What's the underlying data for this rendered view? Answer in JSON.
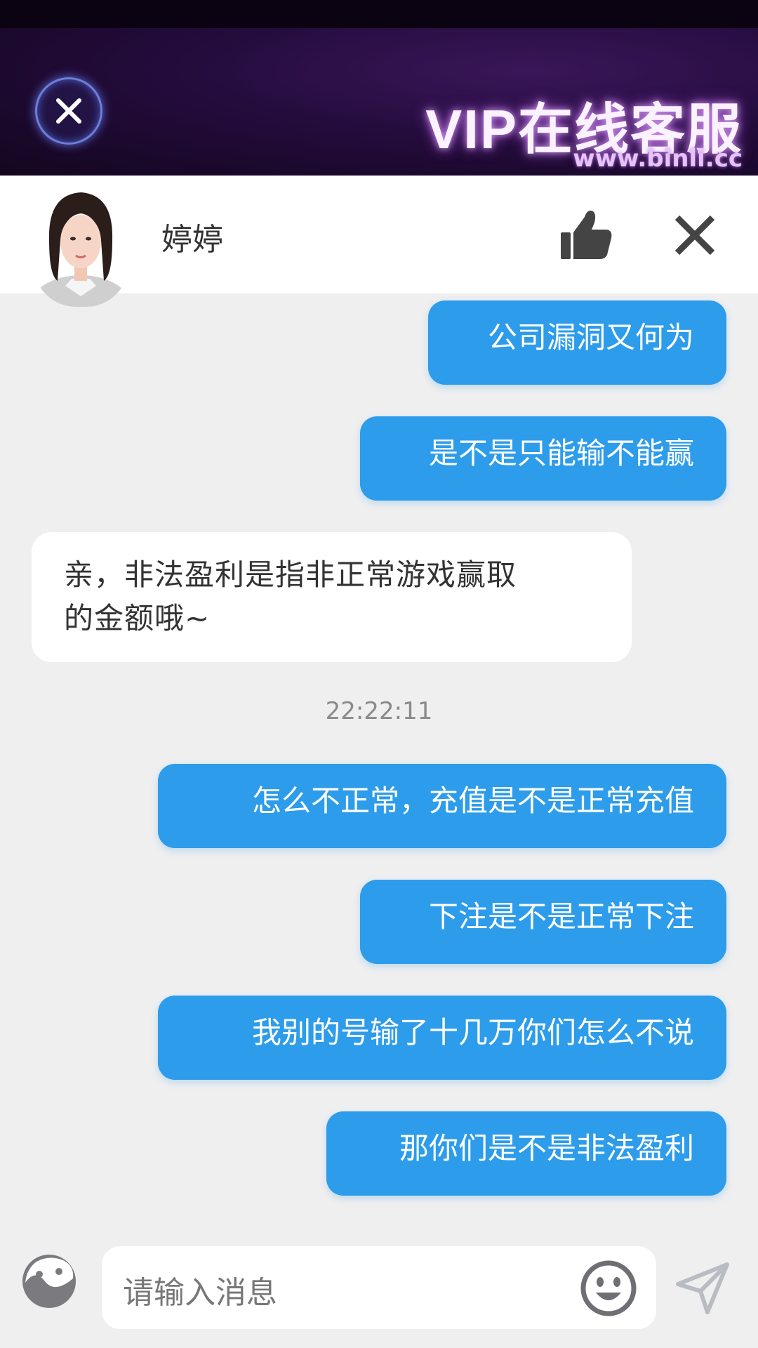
{
  "banner": {
    "title": "VIP在线客服",
    "url": "www.binli.cc"
  },
  "agent": {
    "name": "婷婷"
  },
  "messages": {
    "m1": "公司漏洞又何为",
    "m2": "是不是只能输不能赢",
    "m3_line1": "亲，非法盈利是指非正常游戏赢取",
    "m3_line2": "的金额哦~",
    "timestamp": "22:22:11",
    "m4": "怎么不正常，充值是不是正常充值",
    "m5": "下注是不是正常下注",
    "m6": "我别的号输了十几万你们怎么不说",
    "m7": "那你们是不是非法盈利"
  },
  "input": {
    "placeholder": "请输入消息"
  },
  "colors": {
    "outgoing_bubble": "#2d9cea",
    "incoming_bubble": "#ffffff",
    "background": "#efeff0"
  },
  "icons": {
    "banner_close": "close-circle-icon",
    "like": "thumbs-up-icon",
    "close": "close-icon",
    "emoji_left": "smiley-outline-icon",
    "emoji_right": "smiley-face-icon",
    "send": "paper-plane-icon"
  }
}
